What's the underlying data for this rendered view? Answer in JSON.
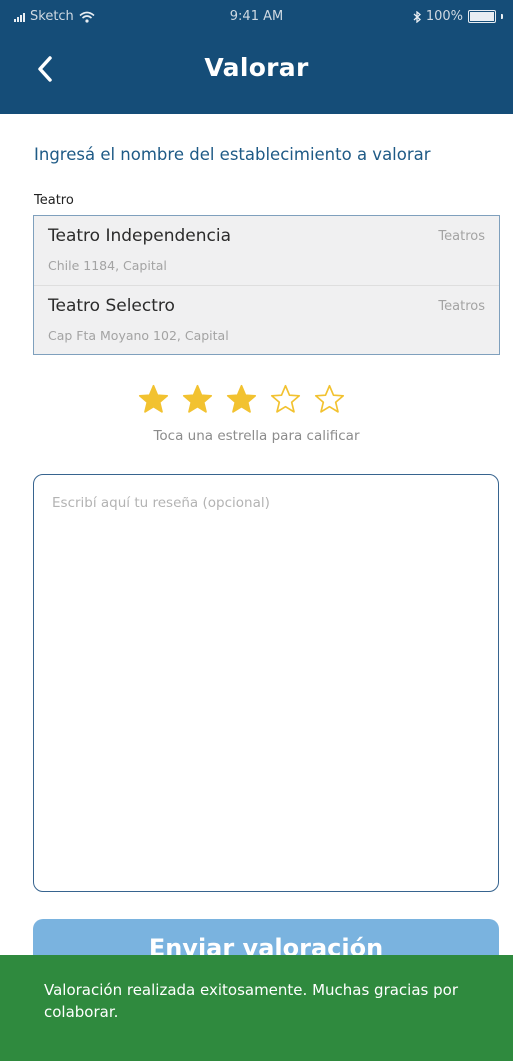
{
  "status_bar": {
    "carrier": "Sketch",
    "time": "9:41 AM",
    "battery": "100%"
  },
  "header": {
    "title": "Valorar"
  },
  "prompt": "Ingresá el nombre del establecimiento a valorar",
  "search": {
    "label": "Teatro"
  },
  "results": [
    {
      "name": "Teatro Independencia",
      "category": "Teatros",
      "address": "Chile 1184, Capital"
    },
    {
      "name": "Teatro Selectro",
      "category": "Teatros",
      "address": "Cap Fta Moyano 102, Capital"
    }
  ],
  "rating": {
    "value": 3,
    "max": 5,
    "hint": "Toca una estrella para calificar",
    "color": "#f2c230"
  },
  "review": {
    "placeholder": "Escribí aquí tu reseña (opcional)",
    "value": ""
  },
  "submit": {
    "label": "Enviar valoración"
  },
  "toast": {
    "message": "Valoración realizada exitosamente. Muchas gracias por colaborar.",
    "color": "#2f8a3e"
  }
}
